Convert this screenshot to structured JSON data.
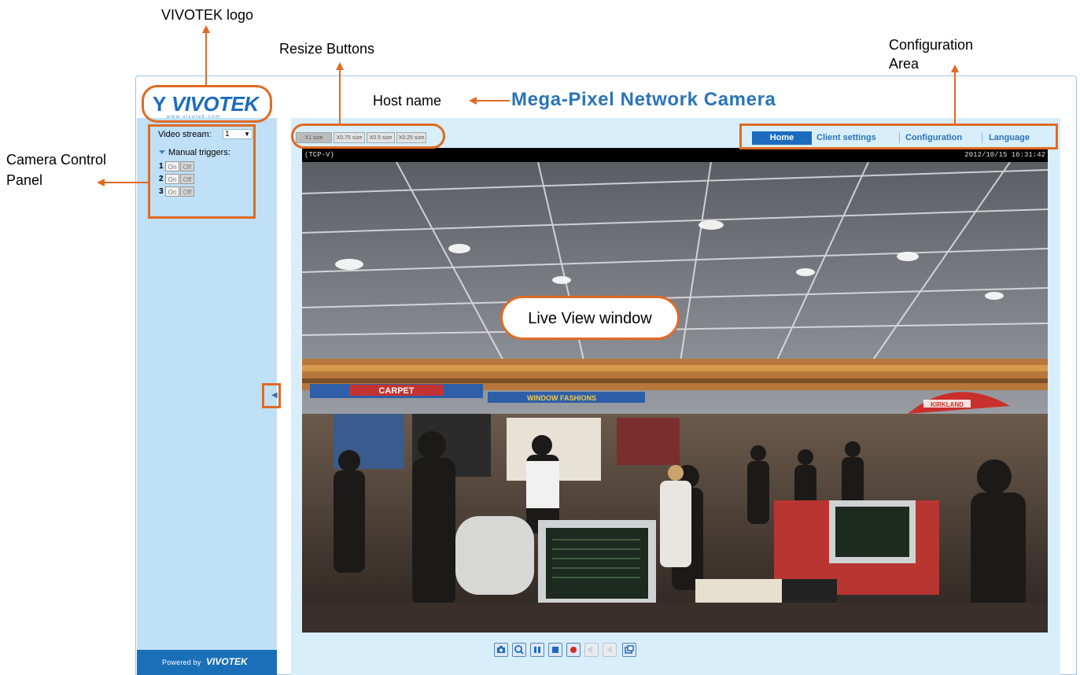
{
  "annotations": {
    "logo": "VIVOTEK logo",
    "resize": "Resize Buttons",
    "configuration_line1": "Configuration",
    "configuration_line2": "Area",
    "host_name": "Host name",
    "camera_control_line1": "Camera Control",
    "camera_control_line2": "Panel",
    "live_view": "Live View window"
  },
  "header": {
    "logo_text": "VIVOTEK",
    "title": "Mega-Pixel Network Camera"
  },
  "sidebar": {
    "video_stream_label": "Video stream:",
    "video_stream_value": "1",
    "manual_triggers_label": "Manual triggers:",
    "triggers": [
      {
        "number": "1",
        "on": "On",
        "off": "Off"
      },
      {
        "number": "2",
        "on": "On",
        "off": "Off"
      },
      {
        "number": "3",
        "on": "On",
        "off": "Off"
      }
    ],
    "footer_powered": "Powered by",
    "footer_logo": "VIVOTEK"
  },
  "resize_buttons": [
    "X1 size",
    "X0.75 size",
    "X0.5 size",
    "X0.25 size"
  ],
  "nav": {
    "home": "Home",
    "client_settings": "Client settings",
    "configuration": "Configuration",
    "language": "Language"
  },
  "video": {
    "protocol": "(TCP-V)",
    "timestamp": "2012/10/15 16:31:42",
    "sign_carpet": "CARPET",
    "sign_window": "WINDOW FASHIONS",
    "sign_kirkland": "KIRKLAND"
  },
  "controls": [
    {
      "name": "snapshot",
      "enabled": true
    },
    {
      "name": "digital-zoom",
      "enabled": true
    },
    {
      "name": "pause",
      "enabled": true
    },
    {
      "name": "stop",
      "enabled": true
    },
    {
      "name": "record",
      "enabled": true
    },
    {
      "name": "volume",
      "enabled": false
    },
    {
      "name": "mute",
      "enabled": false
    },
    {
      "name": "fullscreen",
      "enabled": true
    }
  ],
  "colors": {
    "annotation": "#e06a24",
    "brand_blue": "#1c6bbf",
    "sidebar_bg": "#bfe0f6",
    "panel_bg": "#d9eefb"
  }
}
